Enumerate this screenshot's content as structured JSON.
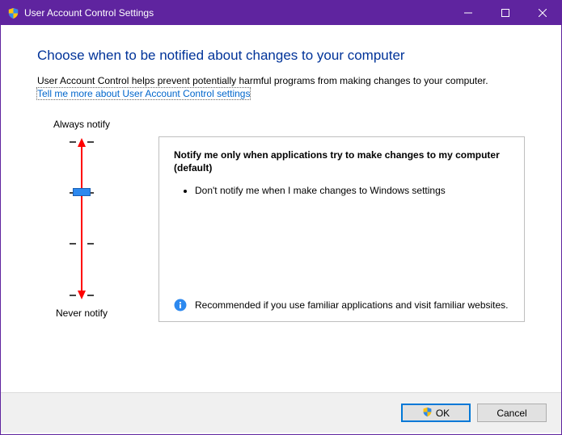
{
  "titlebar": {
    "title": "User Account Control Settings"
  },
  "heading": "Choose when to be notified about changes to your computer",
  "description": "User Account Control helps prevent potentially harmful programs from making changes to your computer.",
  "link_text": "Tell me more about User Account Control settings",
  "slider": {
    "top_label": "Always notify",
    "bottom_label": "Never notify"
  },
  "panel": {
    "title": "Notify me only when applications try to make changes to my computer (default)",
    "bullet1": "Don't notify me when I make changes to Windows settings",
    "recommendation": "Recommended if you use familiar applications and visit familiar websites."
  },
  "footer": {
    "ok": "OK",
    "cancel": "Cancel"
  }
}
